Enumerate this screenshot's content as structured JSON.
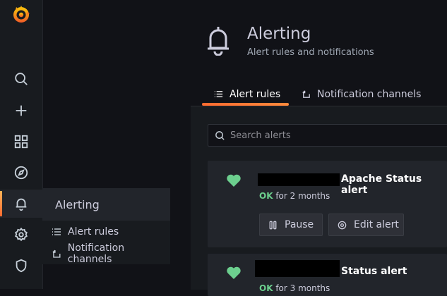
{
  "page": {
    "title": "Alerting",
    "subtitle": "Alert rules and notifications"
  },
  "tabs": [
    {
      "label": "Alert rules",
      "active": true,
      "icon": "list-icon"
    },
    {
      "label": "Notification channels",
      "active": false,
      "icon": "channels-icon"
    }
  ],
  "search": {
    "placeholder": "Search alerts",
    "value": ""
  },
  "sidebar": {
    "items": [
      "search-icon",
      "plus-icon",
      "dashboards-icon",
      "explore-icon",
      "bell-icon",
      "gear-icon",
      "shield-icon"
    ],
    "active": "bell-icon"
  },
  "flyout": {
    "title": "Alerting",
    "items": [
      {
        "label": "Alert rules",
        "icon": "list-icon"
      },
      {
        "label": "Notification channels",
        "icon": "channels-icon"
      }
    ]
  },
  "alerts": [
    {
      "name": "Apache Status alert",
      "state": "OK",
      "duration": "for 2 months",
      "icon": "heart-icon"
    },
    {
      "name": "Status alert",
      "state": "OK",
      "duration": "for 3 months",
      "icon": "heart-icon"
    }
  ],
  "buttons": {
    "pause": "Pause",
    "edit": "Edit alert"
  },
  "colors": {
    "accent": "#ff6b30",
    "ok": "#6ccf8e",
    "background": "#111217",
    "panel": "#181b1f",
    "card": "#22252b"
  }
}
